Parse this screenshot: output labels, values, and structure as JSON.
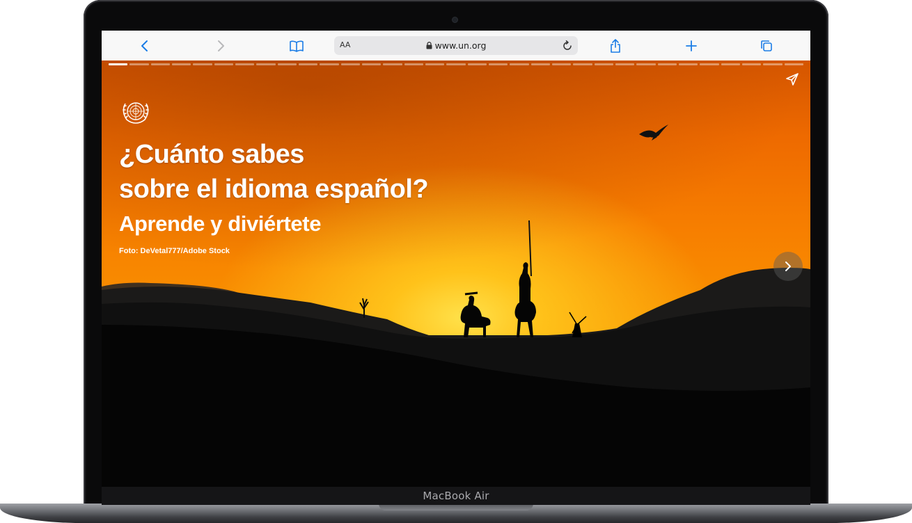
{
  "device": {
    "brand_label": "MacBook Air"
  },
  "browser": {
    "text_size_label": "AA",
    "url": "www.un.org",
    "icons": {
      "back": "chevron-left-icon",
      "forward": "chevron-right-icon",
      "bookmarks": "book-icon",
      "lock": "lock-icon",
      "reload": "reload-icon",
      "share": "share-icon",
      "new_tab": "plus-icon",
      "tabs": "tabs-icon"
    },
    "accent_color": "#1a7ce6"
  },
  "story": {
    "progress": {
      "total_pages": 33,
      "current_page": 1
    },
    "headline_line1": "¿Cuánto sabes",
    "headline_line2": "sobre el idioma español?",
    "subheadline": "Aprende y diviértete",
    "photo_credit": "Foto: DeVetal777/Adobe Stock",
    "icons": {
      "logo": "un-emblem-icon",
      "share": "paper-plane-icon",
      "next": "chevron-right-icon"
    },
    "colors": {
      "sky_top": "#d45500",
      "sky_mid": "#f77f00",
      "sun_glow": "#ffe14a",
      "silhouette": "#000000"
    }
  }
}
